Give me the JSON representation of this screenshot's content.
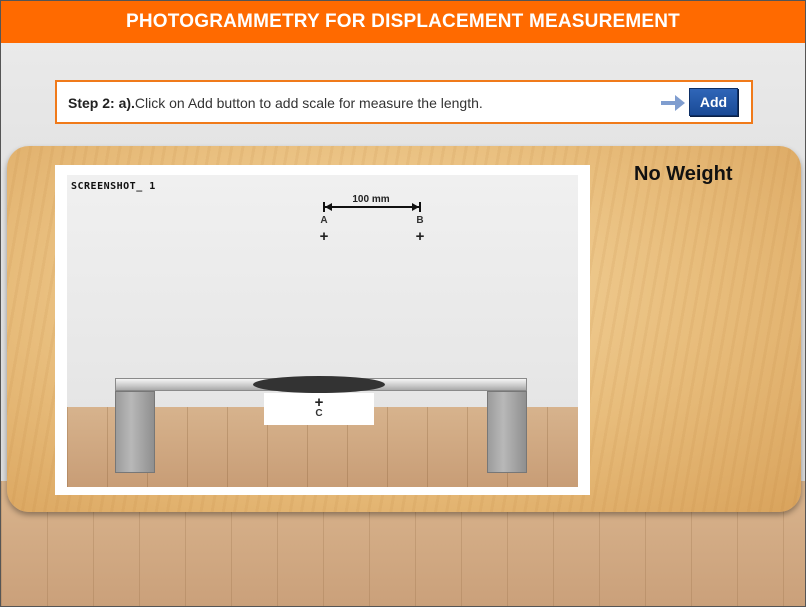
{
  "header": {
    "title": "PHOTOGRAMMETRY FOR DISPLACEMENT MEASUREMENT"
  },
  "instruction": {
    "step_label": "Step 2: a).",
    "text": "Click on Add button to add scale for measure the length.",
    "add_label": "Add"
  },
  "status": {
    "weight_label": "No Weight"
  },
  "screenshot": {
    "label": "SCREENSHOT_ 1",
    "scale_label": "100 mm",
    "points": {
      "a": "A",
      "b": "B",
      "c": "C"
    },
    "marker_glyph": "+"
  },
  "colors": {
    "header_bg": "#ff6a00",
    "instruction_border": "#f07a1a",
    "button_bg": "#1a4a96",
    "arrow": "#7f9dcf"
  },
  "icons": {
    "arrow": "arrow-right-icon",
    "marker": "plus-marker-icon"
  }
}
